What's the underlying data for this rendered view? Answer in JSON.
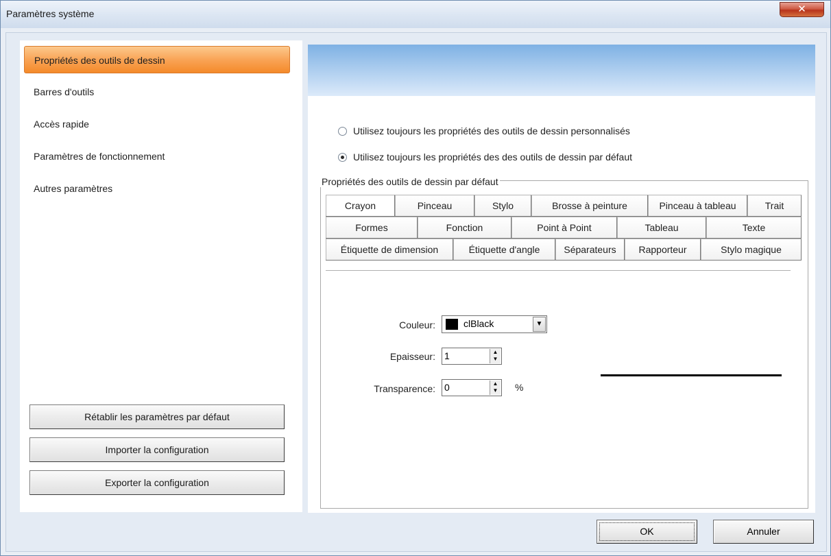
{
  "window": {
    "title": "Paramètres système",
    "close_glyph": "✕"
  },
  "sidebar": {
    "items": [
      {
        "label": "Propriétés des outils de dessin",
        "selected": true
      },
      {
        "label": "Barres d'outils"
      },
      {
        "label": "Accès rapide"
      },
      {
        "label": "Paramètres de fonctionnement"
      },
      {
        "label": "Autres paramètres"
      }
    ],
    "buttons": {
      "restore": "Rétablir les paramètres par défaut",
      "import": "Importer la configuration",
      "export": "Exporter la configuration"
    }
  },
  "main": {
    "radios": [
      {
        "label": "Utilisez toujours les propriétés des outils de dessin personnalisés",
        "checked": false
      },
      {
        "label": "Utilisez toujours les propriétés des des outils de dessin par défaut",
        "checked": true
      }
    ],
    "group_title": "Propriétés des outils de dessin par défaut",
    "tabs_row1": [
      "Crayon",
      "Pinceau",
      "Stylo",
      "Brosse à peinture",
      "Pinceau à tableau",
      "Trait"
    ],
    "tabs_row2": [
      "Formes",
      "Fonction",
      "Point à Point",
      "Tableau",
      "Texte"
    ],
    "tabs_row3": [
      "Étiquette de dimension",
      "Étiquette d'angle",
      "Séparateurs",
      "Rapporteur",
      "Stylo magique"
    ],
    "active_tab": "Crayon",
    "fields": {
      "color_label": "Couleur:",
      "color_value": "clBlack",
      "color_hex": "#000000",
      "thickness_label": "Epaisseur:",
      "thickness_value": "1",
      "transparency_label": "Transparence:",
      "transparency_value": "0",
      "transparency_unit": "%"
    }
  },
  "footer": {
    "ok": "OK",
    "cancel": "Annuler"
  }
}
